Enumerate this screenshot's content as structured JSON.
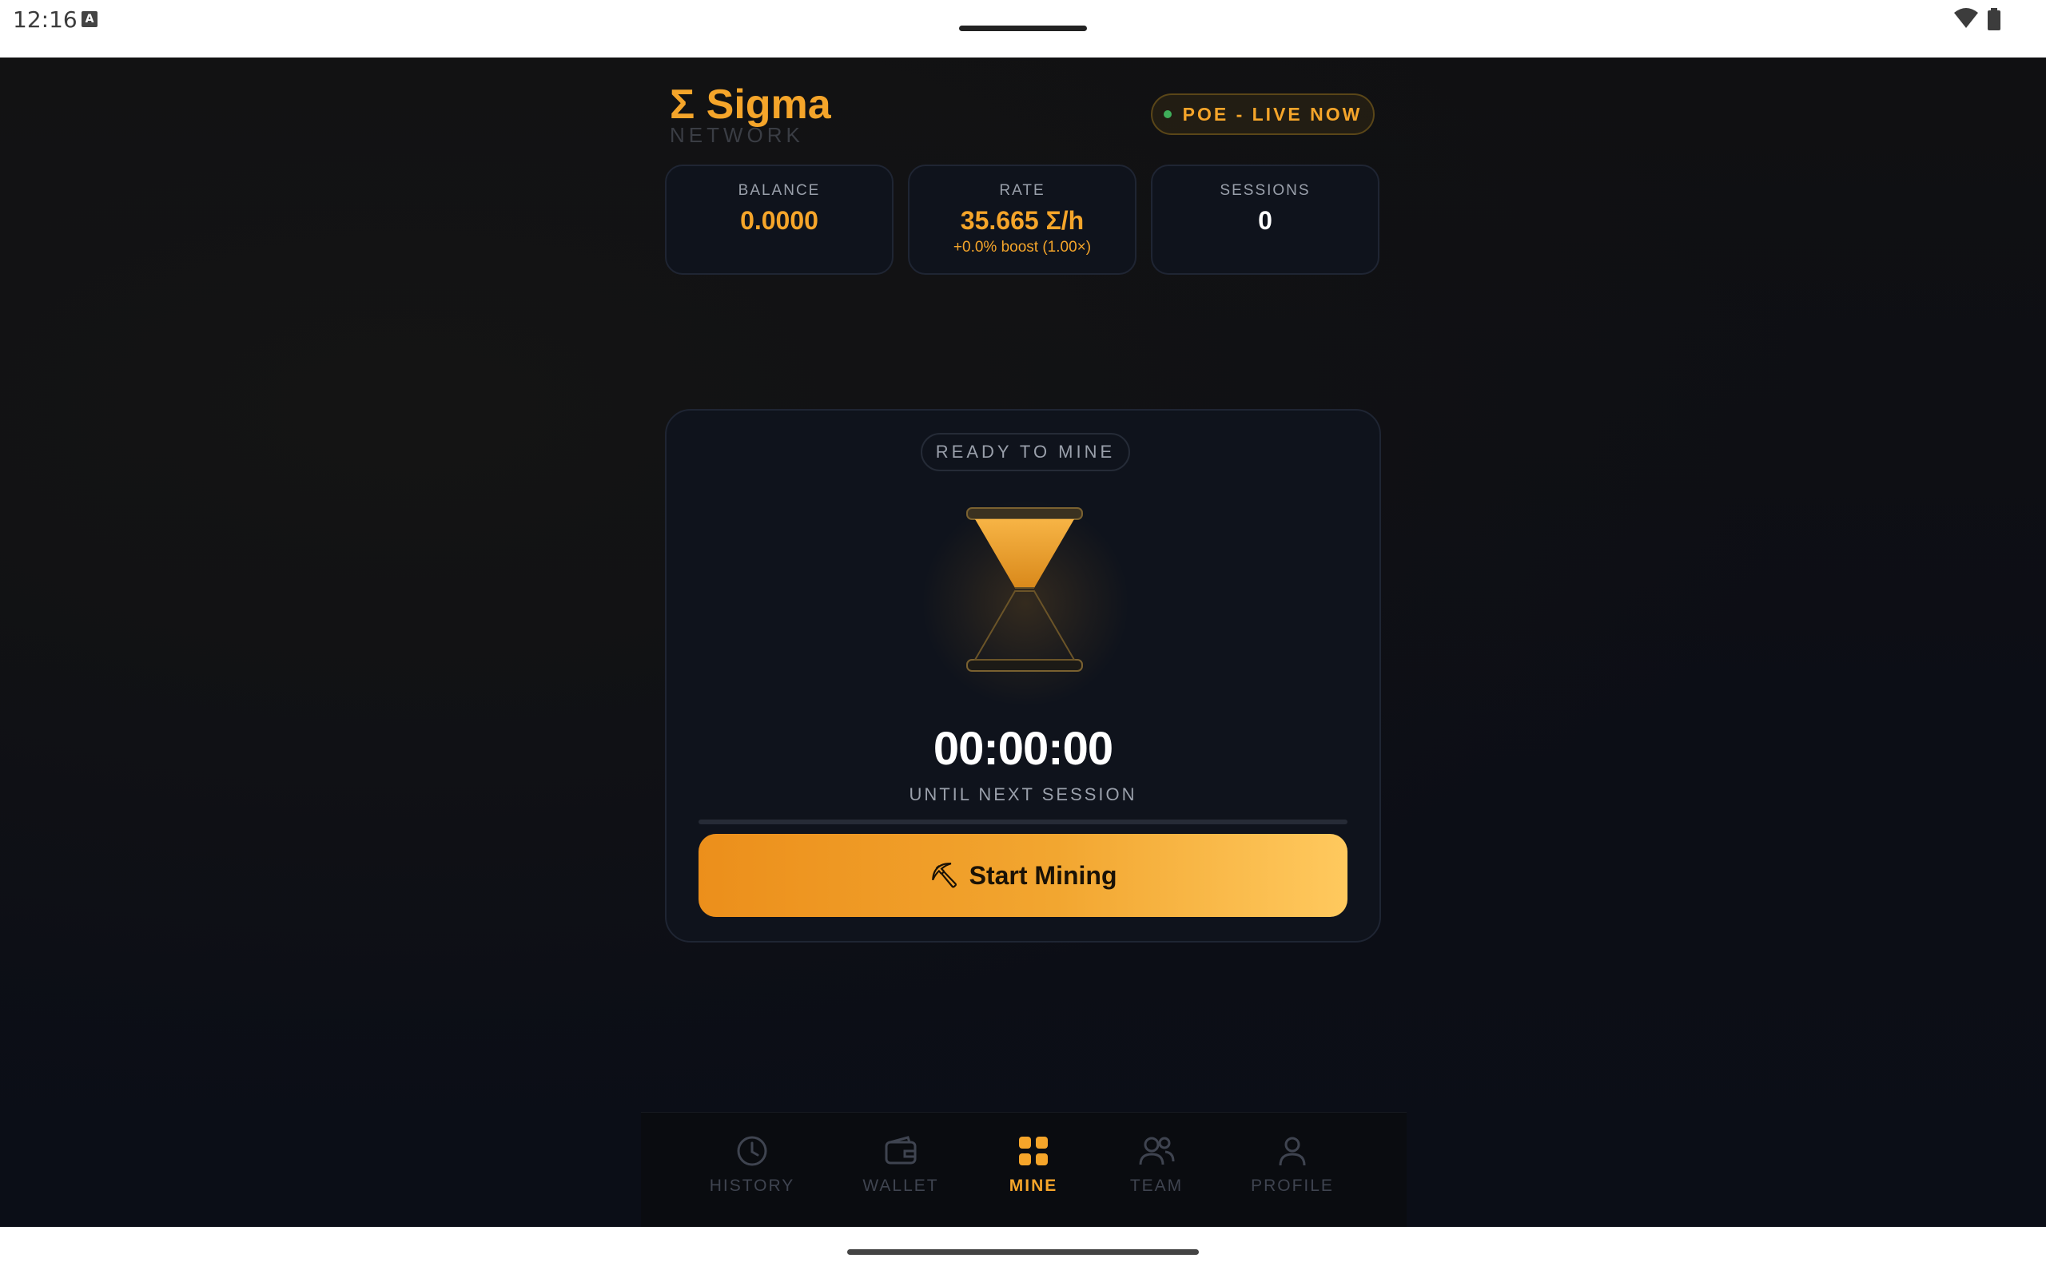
{
  "status_bar": {
    "time": "12:16",
    "notification_icon": "a-box-icon"
  },
  "brand": {
    "title": "Σ Sigma",
    "subtitle": "NETWORK",
    "accent_color": "#f5a52a"
  },
  "live_badge": {
    "label": "POE - LIVE NOW",
    "dot_color": "#3fae5a"
  },
  "stats": [
    {
      "label": "BALANCE",
      "value": "0.0000",
      "sub": ""
    },
    {
      "label": "RATE",
      "value": "35.665 Σ/h",
      "sub": "+0.0% boost (1.00×)"
    },
    {
      "label": "SESSIONS",
      "value": "0",
      "sub": ""
    }
  ],
  "mining": {
    "status": "READY TO MINE",
    "timer": "00:00:00",
    "timer_label": "UNTIL NEXT SESSION",
    "progress_percent": 0,
    "button_icon": "pickaxe-icon",
    "button_label": "Start Mining"
  },
  "nav": {
    "active": "MINE",
    "items": [
      {
        "label": "HISTORY",
        "icon": "clock-icon"
      },
      {
        "label": "WALLET",
        "icon": "wallet-icon"
      },
      {
        "label": "MINE",
        "icon": "grid-icon"
      },
      {
        "label": "TEAM",
        "icon": "team-icon"
      },
      {
        "label": "PROFILE",
        "icon": "user-icon"
      }
    ]
  }
}
